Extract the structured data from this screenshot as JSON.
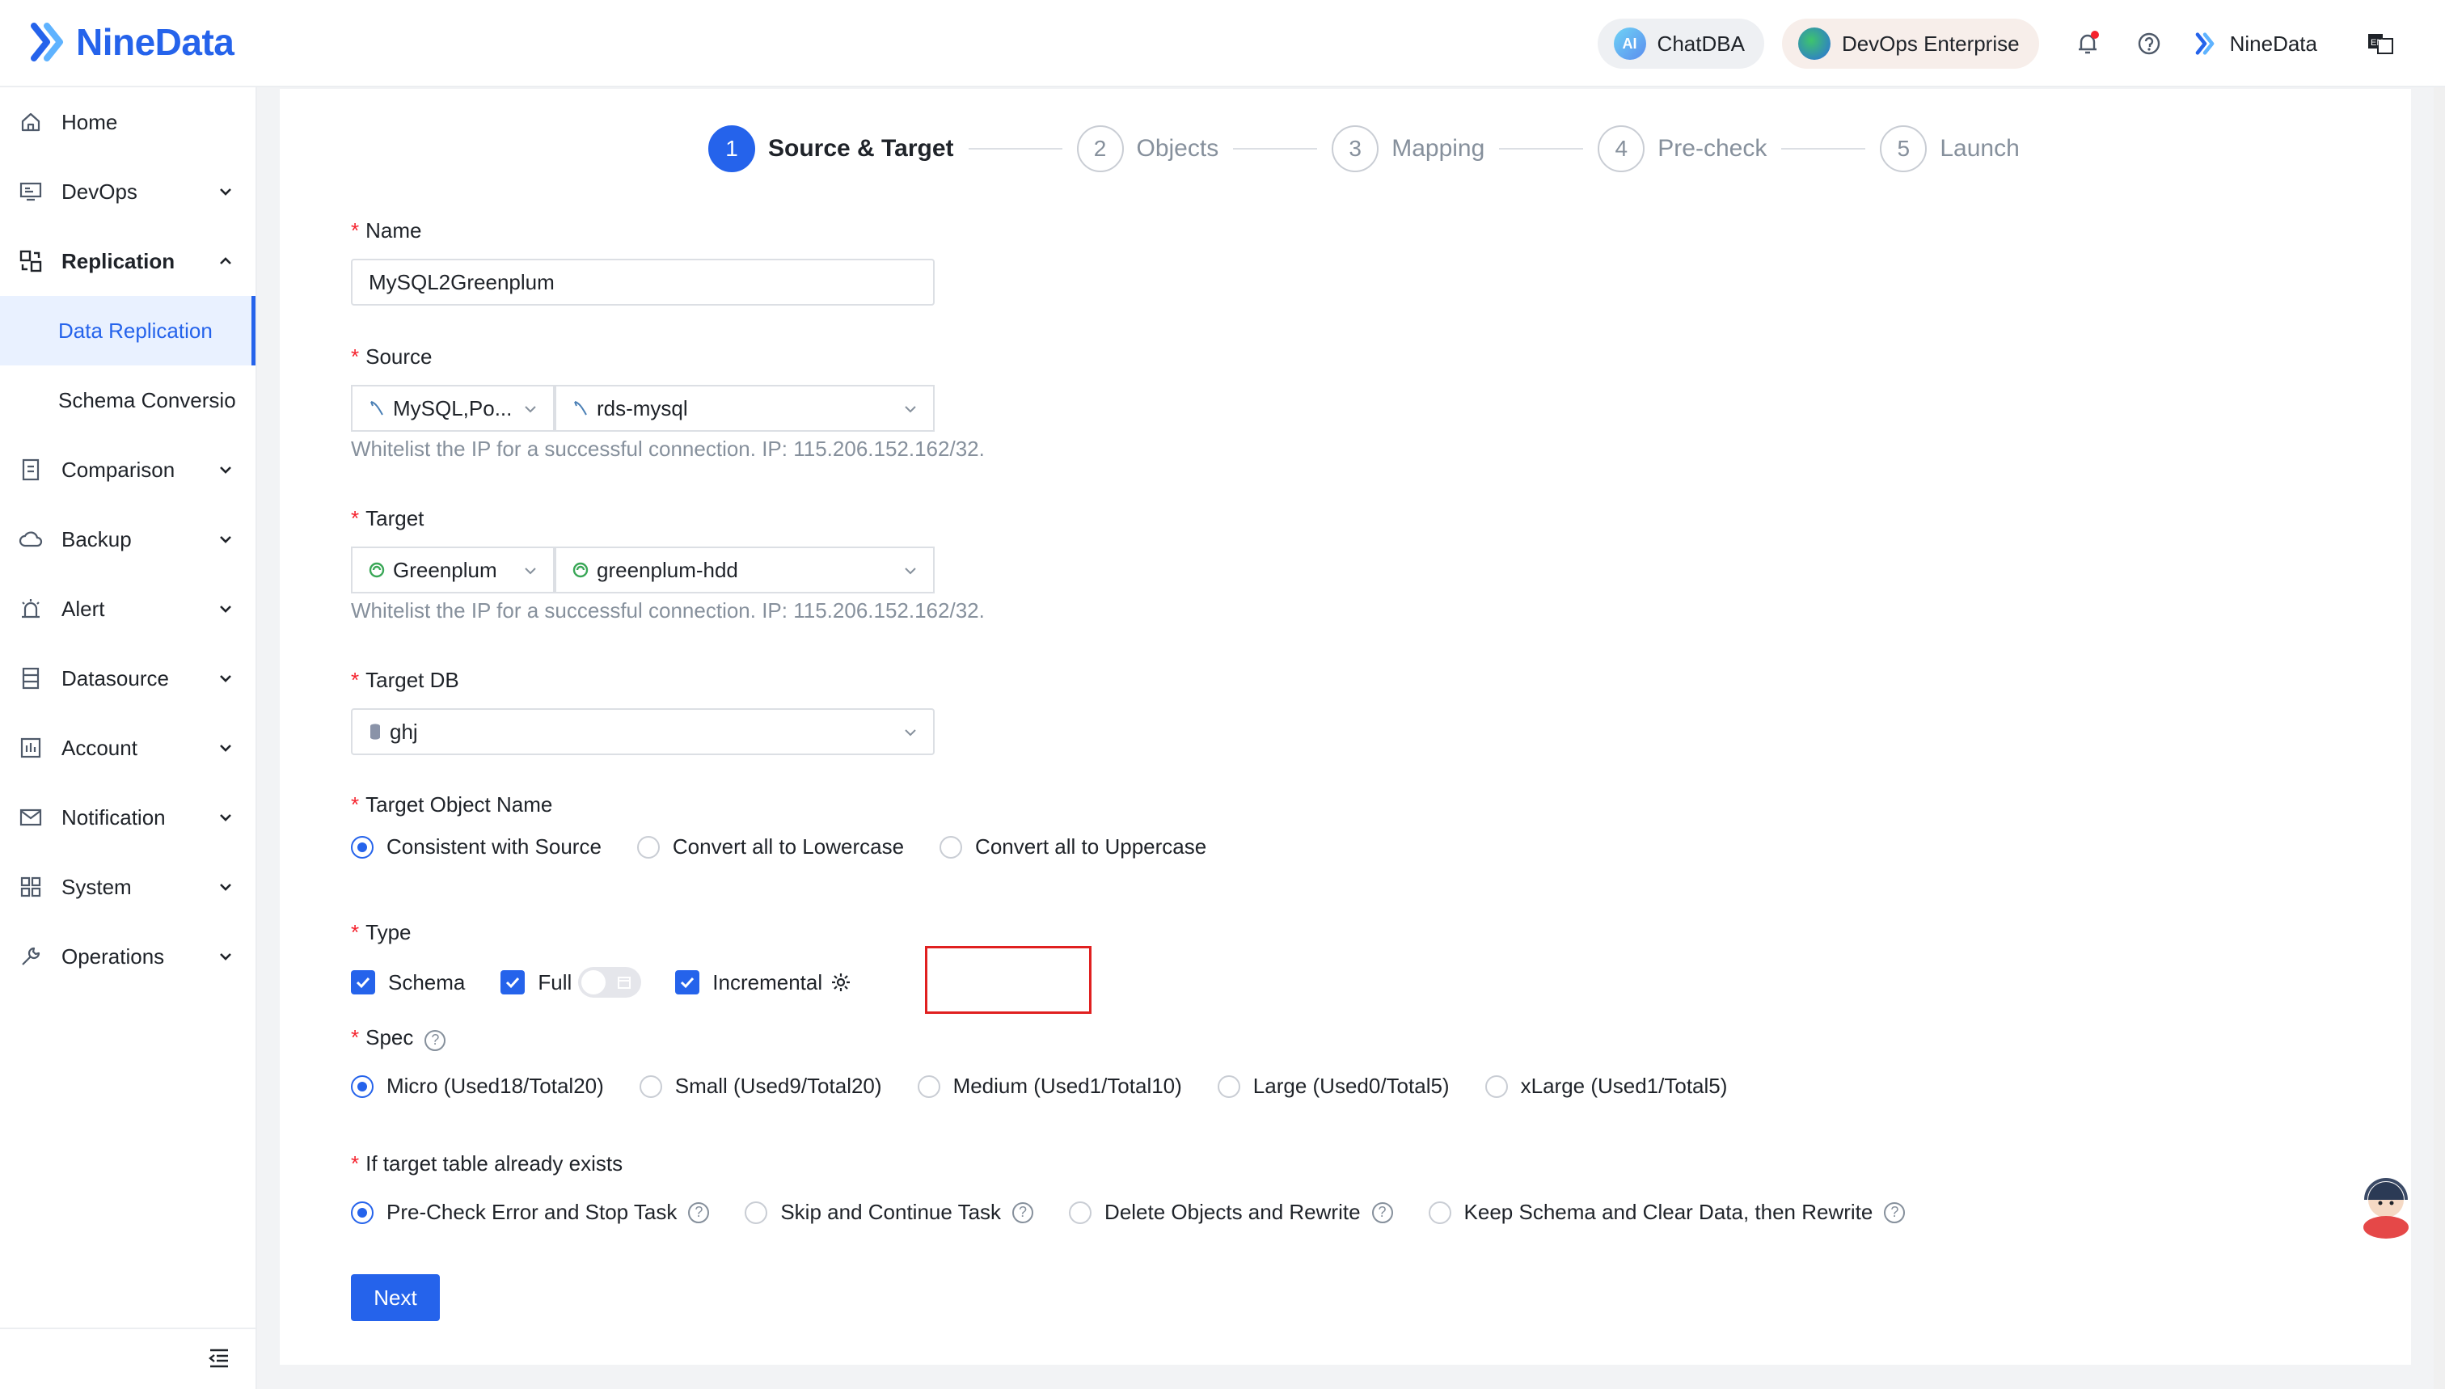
{
  "brand": {
    "name": "NineData",
    "color": "#2563eb"
  },
  "header": {
    "chatdba": "ChatDBA",
    "chatdba_icon_text": "AI",
    "devops": "DevOps Enterprise",
    "user": "NineData"
  },
  "sidebar": {
    "items": [
      {
        "label": "Home",
        "icon": "home-icon"
      },
      {
        "label": "DevOps",
        "icon": "devops-icon"
      },
      {
        "label": "Replication",
        "icon": "replication-icon"
      },
      {
        "label": "Comparison",
        "icon": "comparison-icon"
      },
      {
        "label": "Backup",
        "icon": "backup-icon"
      },
      {
        "label": "Alert",
        "icon": "alert-icon"
      },
      {
        "label": "Datasource",
        "icon": "datasource-icon"
      },
      {
        "label": "Account",
        "icon": "account-icon"
      },
      {
        "label": "Notification",
        "icon": "mail-icon"
      },
      {
        "label": "System",
        "icon": "system-icon"
      },
      {
        "label": "Operations",
        "icon": "wrench-icon"
      }
    ],
    "sub_items": [
      "Data Replication",
      "Schema Conversio"
    ]
  },
  "steps": [
    {
      "num": "1",
      "label": "Source & Target"
    },
    {
      "num": "2",
      "label": "Objects"
    },
    {
      "num": "3",
      "label": "Mapping"
    },
    {
      "num": "4",
      "label": "Pre-check"
    },
    {
      "num": "5",
      "label": "Launch"
    }
  ],
  "form": {
    "name": {
      "label": "Name",
      "value": "MySQL2Greenplum"
    },
    "source": {
      "label": "Source",
      "type": "MySQL,Po...",
      "instance": "rds-mysql",
      "hint": "Whitelist the IP for a successful connection. IP: 115.206.152.162/32."
    },
    "target": {
      "label": "Target",
      "type": "Greenplum",
      "instance": "greenplum-hdd",
      "hint": "Whitelist the IP for a successful connection. IP: 115.206.152.162/32."
    },
    "target_db": {
      "label": "Target DB",
      "value": "ghj"
    },
    "target_object_name": {
      "label": "Target Object Name",
      "options": [
        "Consistent with Source",
        "Convert all to Lowercase",
        "Convert all to Uppercase"
      ],
      "selected": "Consistent with Source"
    },
    "type": {
      "label": "Type",
      "schema": "Schema",
      "full": "Full",
      "incremental": "Incremental"
    },
    "spec": {
      "label": "Spec",
      "options": [
        "Micro (Used18/Total20)",
        "Small (Used9/Total20)",
        "Medium (Used1/Total10)",
        "Large (Used0/Total5)",
        "xLarge (Used1/Total5)"
      ],
      "selected": "Micro (Used18/Total20)"
    },
    "if_exists": {
      "label": "If target table already exists",
      "options": [
        "Pre-Check Error and Stop Task",
        "Skip and Continue Task",
        "Delete Objects and Rewrite",
        "Keep Schema and Clear Data, then Rewrite"
      ],
      "selected": "Pre-Check Error and Stop Task"
    },
    "help_glyph": "?",
    "next": "Next"
  }
}
